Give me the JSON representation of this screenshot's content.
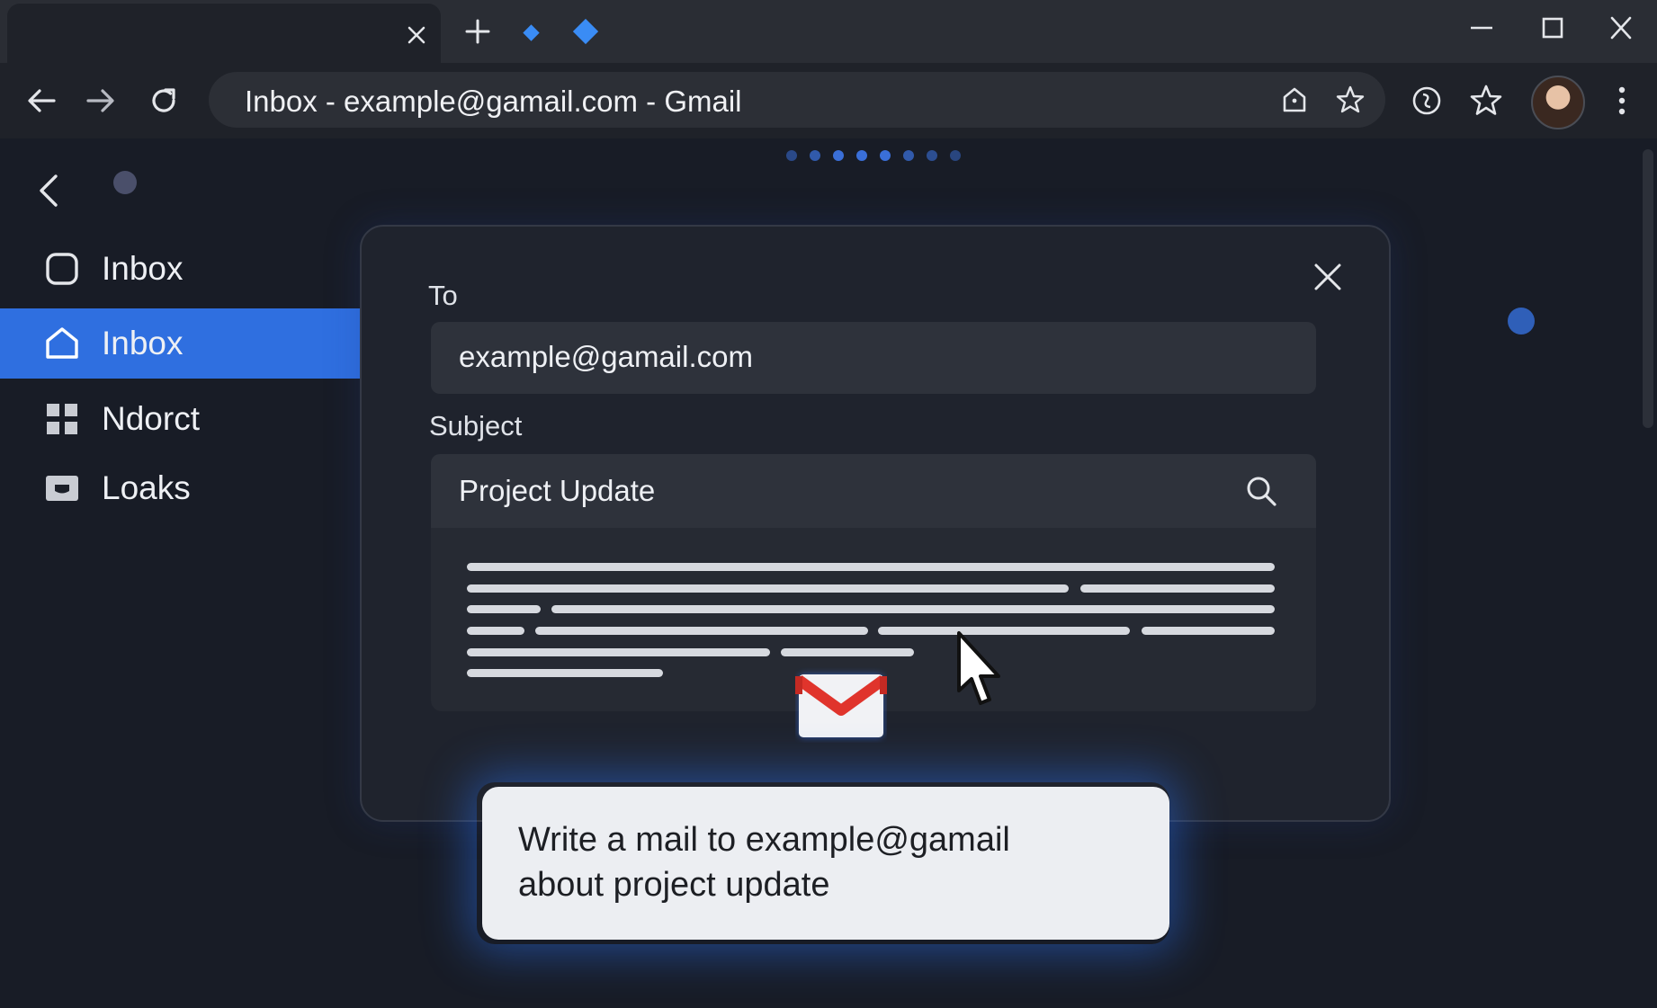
{
  "browser": {
    "address_text": "Inbox - example@gamail.com - Gmail",
    "traffic_colors": [
      "#ed5b52",
      "#f5b83c",
      "#3bc14a"
    ],
    "accent": "#3a8cf5"
  },
  "sidebar": {
    "items": [
      {
        "label": "Inbox",
        "icon": "square-outline-icon",
        "active": false
      },
      {
        "label": "Inbox",
        "icon": "home-icon",
        "active": true
      },
      {
        "label": "Ndorct",
        "icon": "grid-icon",
        "active": false
      },
      {
        "label": "Loaks",
        "icon": "folder-icon",
        "active": false
      }
    ],
    "active_color": "#2f6fe0"
  },
  "compose": {
    "to_label": "To",
    "to_value": "example@gamail.com",
    "subject_label": "Subject",
    "subject_value": "Project Update"
  },
  "prompt": {
    "text": "Write a mail to example@gamail about project update"
  }
}
